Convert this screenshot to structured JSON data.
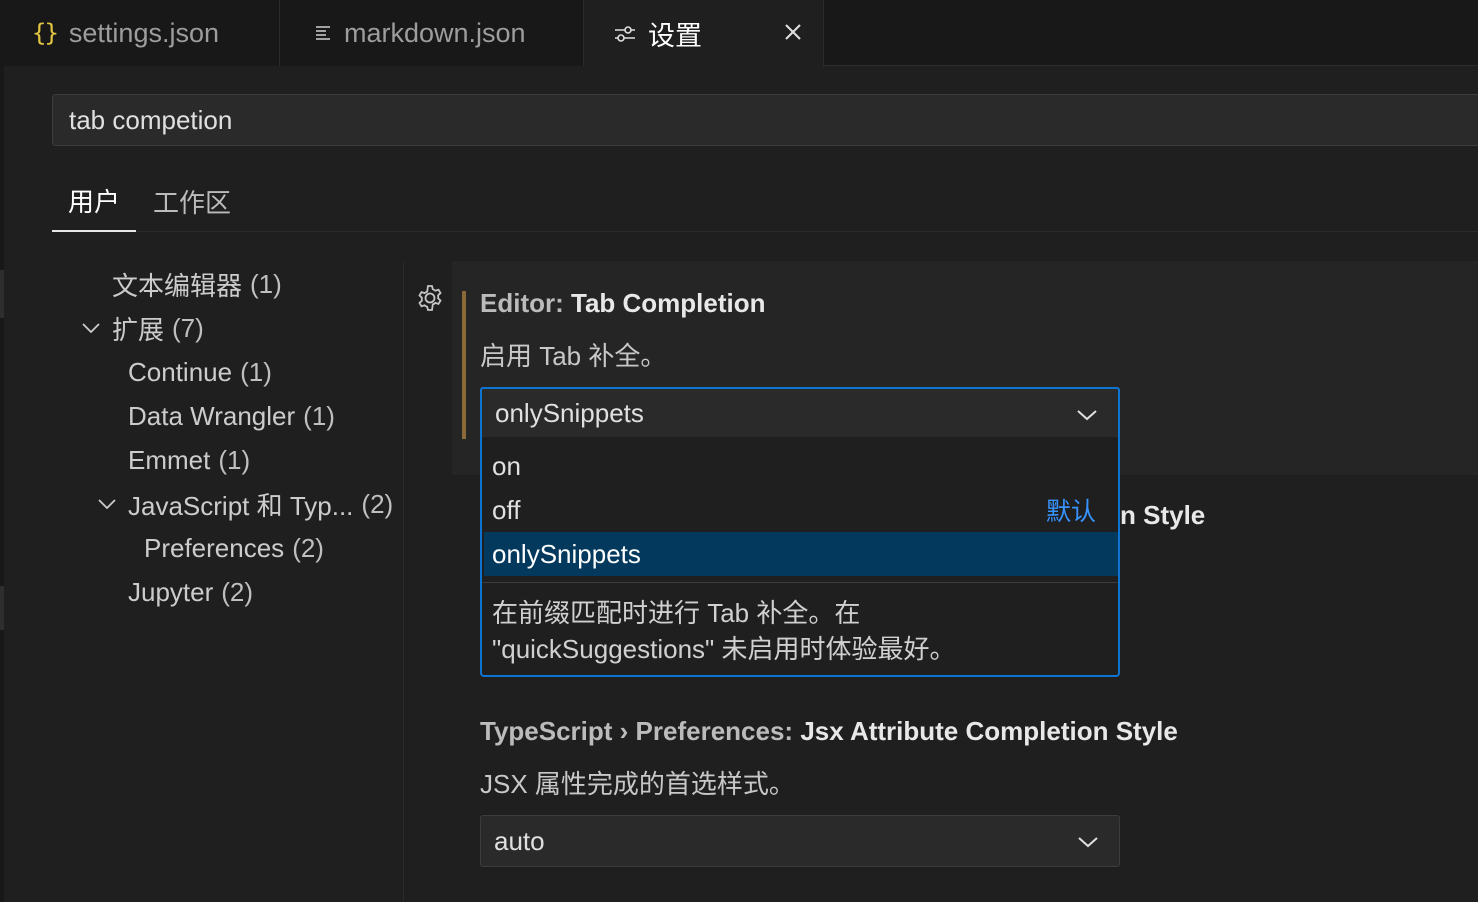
{
  "tabs": [
    {
      "label": "settings.json",
      "icon": "braces-icon"
    },
    {
      "label": "markdown.json",
      "icon": "lines-icon"
    },
    {
      "label": "设置",
      "icon": "settings-sliders-icon"
    }
  ],
  "search": {
    "value": "tab competion"
  },
  "scope_tabs": {
    "user": "用户",
    "workspace": "工作区"
  },
  "toc": {
    "items": [
      {
        "label": "文本编辑器",
        "count": "(1)"
      },
      {
        "label": "扩展",
        "count": "(7)"
      },
      {
        "label": "Continue",
        "count": "(1)"
      },
      {
        "label": "Data Wrangler",
        "count": "(1)"
      },
      {
        "label": "Emmet",
        "count": "(1)"
      },
      {
        "label": "JavaScript 和 Typ...",
        "count": "(2)"
      },
      {
        "label": "Preferences",
        "count": "(2)"
      },
      {
        "label": "Jupyter",
        "count": "(2)"
      }
    ]
  },
  "setting1": {
    "category": "Editor: ",
    "name": "Tab Completion",
    "description": "启用 Tab 补全。",
    "value": "onlySnippets",
    "options": [
      {
        "label": "on"
      },
      {
        "label": "off",
        "default_tag": "默认"
      },
      {
        "label": "onlySnippets"
      }
    ],
    "option_description": [
      "在前缀匹配时进行 Tab 补全。在",
      "\"quickSuggestions\" 未启用时体验最好。"
    ]
  },
  "hidden_title_tail": "n Style",
  "setting3": {
    "category": "TypeScript › Preferences: ",
    "name": "Jsx Attribute Completion Style",
    "description": "JSX 属性完成的首选样式。",
    "value": "auto"
  },
  "colors": {
    "accent": "#0e73d1",
    "selected_option": "#04395e",
    "default_tag": "#3794ff",
    "modified_indicator": "#8a6a38",
    "json_brace": "#e2c541"
  }
}
